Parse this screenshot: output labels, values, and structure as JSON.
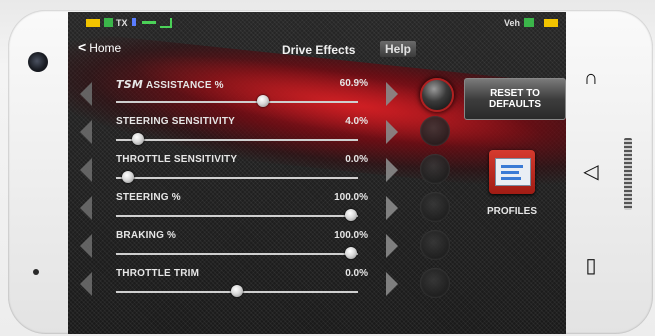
{
  "status_bar": {
    "tx_label": "TX",
    "veh_label": "Veh",
    "icons": [
      "battery-icon",
      "tx-icon",
      "bluetooth-icon",
      "link-icon",
      "signal-icon",
      "vehicle-icon",
      "battery-icon"
    ]
  },
  "header": {
    "back_label": "Home",
    "title": "Drive Effects",
    "help_label": "Help"
  },
  "rows": [
    {
      "prefix": "TSM",
      "label": "ASSISTANCE %",
      "value": "60.9%",
      "slider_fraction": 0.609,
      "active": true
    },
    {
      "prefix": "",
      "label": "STEERING SENSITIVITY",
      "value": "4.0%",
      "slider_fraction": 0.09,
      "active": false
    },
    {
      "prefix": "",
      "label": "THROTTLE SENSITIVITY",
      "value": "0.0%",
      "slider_fraction": 0.05,
      "active": false
    },
    {
      "prefix": "",
      "label": "STEERING %",
      "value": "100.0%",
      "slider_fraction": 0.97,
      "active": false
    },
    {
      "prefix": "",
      "label": "BRAKING %",
      "value": "100.0%",
      "slider_fraction": 0.97,
      "active": false
    },
    {
      "prefix": "",
      "label": "THROTTLE TRIM",
      "value": "0.0%",
      "slider_fraction": 0.5,
      "active": false
    }
  ],
  "actions": {
    "reset_label_line1": "RESET TO",
    "reset_label_line2": "DEFAULTS",
    "profiles_label": "PROFILES"
  },
  "colors": {
    "accent_red": "#b02020",
    "status_green": "#3bb54a",
    "battery_yellow": "#f2c400"
  }
}
